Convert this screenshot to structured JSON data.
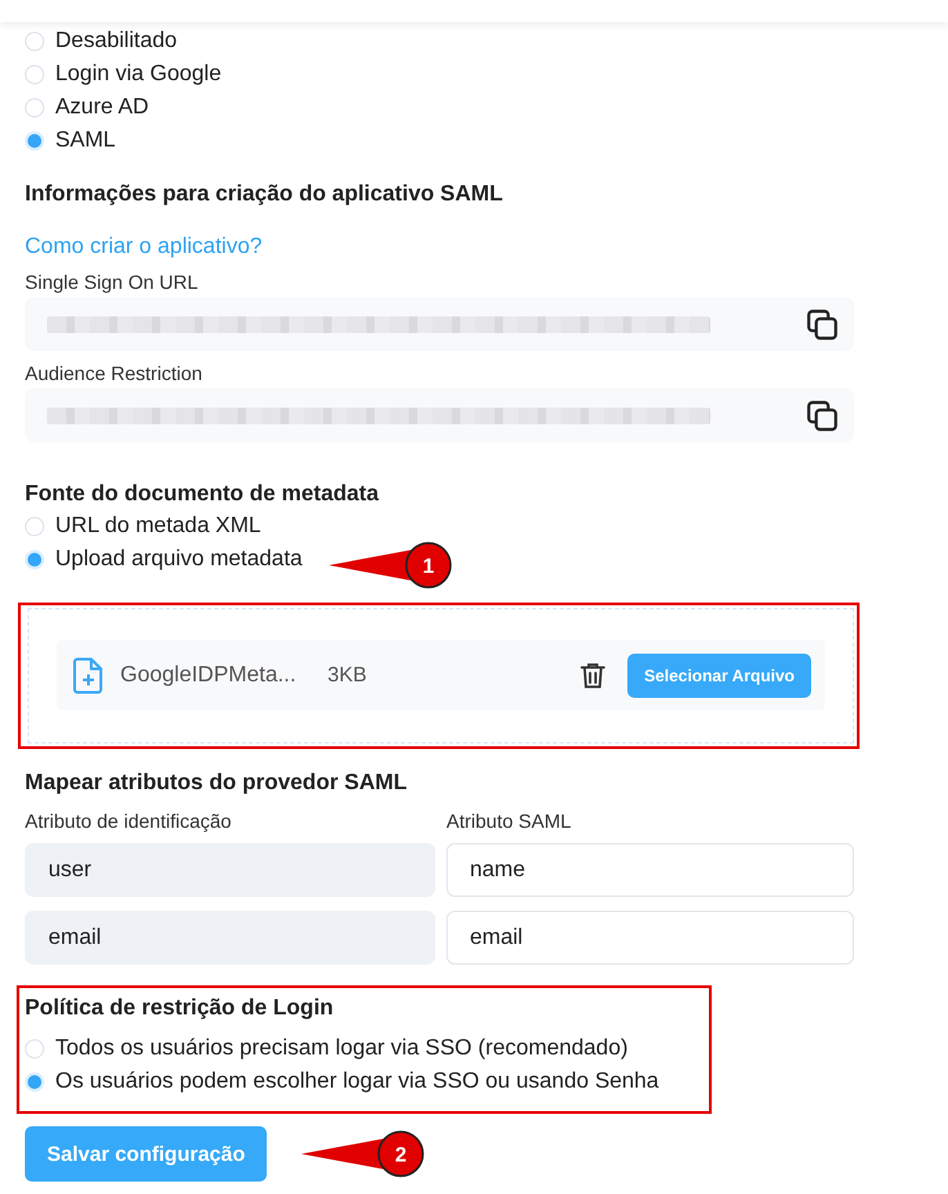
{
  "sso_section": {
    "options": [
      {
        "label": "Desabilitado",
        "selected": false
      },
      {
        "label": "Login via Google",
        "selected": false
      },
      {
        "label": "Azure AD",
        "selected": false
      },
      {
        "label": "SAML",
        "selected": true
      }
    ]
  },
  "saml_app": {
    "title": "Informações para criação do aplicativo SAML",
    "help_link": "Como criar o aplicativo?",
    "fields": [
      {
        "label": "Single Sign On URL"
      },
      {
        "label": "Audience Restriction"
      }
    ]
  },
  "metadata_source": {
    "title": "Fonte do documento de metadata",
    "options": [
      {
        "label": "URL do metada XML",
        "selected": false
      },
      {
        "label": "Upload arquivo metadata",
        "selected": true
      }
    ],
    "file": {
      "name": "GoogleIDPMeta...",
      "size": "3KB",
      "button": "Selecionar Arquivo"
    }
  },
  "attribute_mapping": {
    "title": "Mapear atributos do provedor SAML",
    "columns": [
      "Atributo de identificação",
      "Atributo SAML"
    ],
    "rows": [
      {
        "identifier": "user",
        "saml_attribute": "name"
      },
      {
        "identifier": "email",
        "saml_attribute": "email"
      }
    ]
  },
  "login_policy": {
    "title": "Política de restrição de Login",
    "options": [
      {
        "label": "Todos os usuários precisam logar via SSO (recomendado)",
        "selected": false
      },
      {
        "label": "Os usuários podem escolher logar via SSO ou usando Senha",
        "selected": true
      }
    ]
  },
  "save_button": "Salvar configuração",
  "annotations": [
    {
      "label": "1"
    },
    {
      "label": "2"
    }
  ]
}
